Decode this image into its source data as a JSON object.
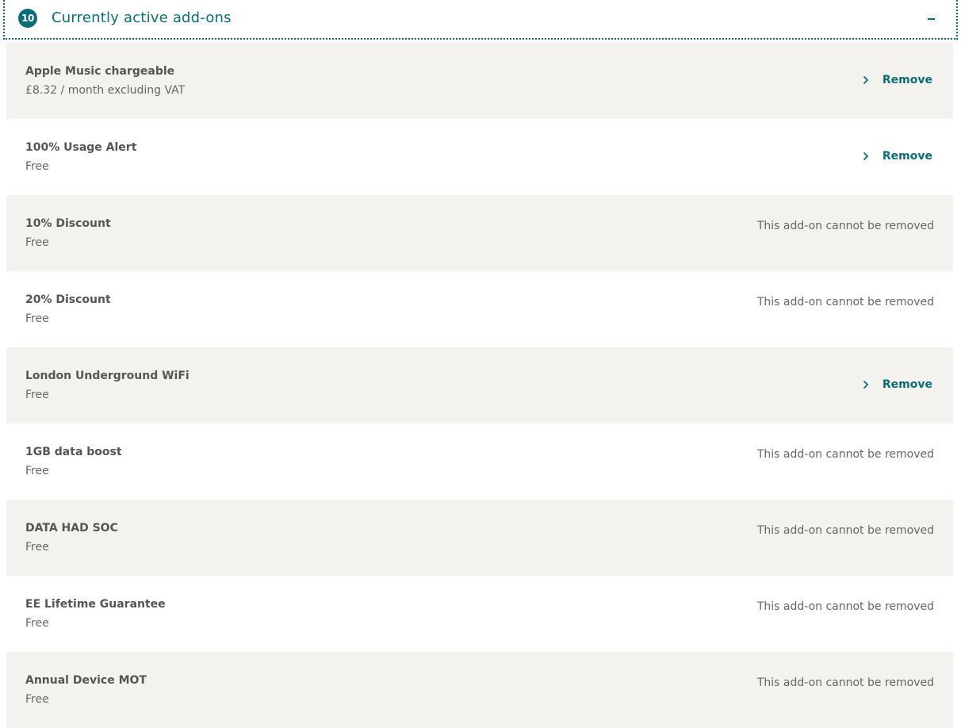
{
  "header": {
    "count": "10",
    "title": "Currently active add-ons",
    "collapse_icon": "minus-icon"
  },
  "colors": {
    "accent": "#0a6e78",
    "row_shaded": "#f3f2ef",
    "text": "#555555"
  },
  "addons": [
    {
      "name": "Apple Music chargeable",
      "price": "£8.32 / month excluding VAT",
      "removable": true,
      "action": "Remove"
    },
    {
      "name": "100% Usage Alert",
      "price": "Free",
      "removable": true,
      "action": "Remove"
    },
    {
      "name": "10% Discount",
      "price": "Free",
      "removable": false,
      "action": "This add-on cannot be removed"
    },
    {
      "name": "20% Discount",
      "price": "Free",
      "removable": false,
      "action": "This add-on cannot be removed"
    },
    {
      "name": "London Underground WiFi",
      "price": "Free",
      "removable": true,
      "action": "Remove"
    },
    {
      "name": "1GB data boost",
      "price": "Free",
      "removable": false,
      "action": "This add-on cannot be removed"
    },
    {
      "name": "DATA HAD SOC",
      "price": "Free",
      "removable": false,
      "action": "This add-on cannot be removed"
    },
    {
      "name": "EE Lifetime Guarantee",
      "price": "Free",
      "removable": false,
      "action": "This add-on cannot be removed"
    },
    {
      "name": "Annual Device MOT",
      "price": "Free",
      "removable": false,
      "action": "This add-on cannot be removed"
    }
  ]
}
